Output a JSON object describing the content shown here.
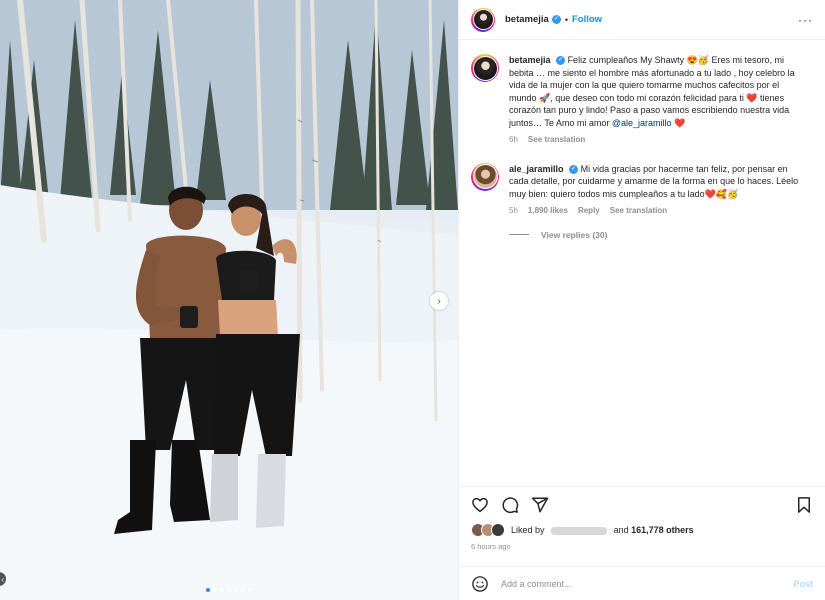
{
  "header": {
    "username": "betamejia",
    "separator": "•",
    "follow_label": "Follow",
    "more_label": "···"
  },
  "caption": {
    "username": "betamejia",
    "text_a": "Feliz cumpleaños My Shawty 😍🥳 Eres mi tesoro, mi bebita … me siento el hombre más afortunado a tu lado , hoy celebro la vida de la mujer con la que quiero tomarme muchos cafecitos por el mundo 🚀, que deseo con todo mi corazón felicidad para ti ❤️ tienes corazón tan puro y lindo! Paso a paso vamos escribiendo nuestra vida juntos… Te Amo mi amor ",
    "mention": "@ale_jaramillo",
    "text_b": " ❤️",
    "time": "6h",
    "see_translation": "See translation"
  },
  "reply": {
    "username": "ale_jaramillo",
    "text": "Mi vida gracias por hacerme tan feliz, por pensar en cada detalle, por cuidarme y amarme de la forma en que lo haces. Léelo muy bien: quiero todos mis cumpleaños a tu lado❤️🥰🥳",
    "time": "5h",
    "likes": "1,890 likes",
    "reply_label": "Reply",
    "see_translation": "See translation",
    "heart": "♡",
    "view_replies": "View replies (30)"
  },
  "likes": {
    "liked_by": "Liked by",
    "and_text": "and",
    "count": "161,778 others",
    "time": "6 hours ago"
  },
  "comment_box": {
    "placeholder": "Add a comment...",
    "post_label": "Post"
  },
  "carousel": {
    "next": "›",
    "prev": "‹",
    "dot_count": 7,
    "active_index": 0
  },
  "colors": {
    "accent": "#0095f6",
    "verified": "#3897f0",
    "secondary_text": "#8e8e8e",
    "heart": "#ed4956"
  },
  "icons": [
    "heart-icon",
    "comment-icon",
    "share-icon",
    "bookmark-icon",
    "emoji-icon",
    "verified-icon",
    "more-icon"
  ]
}
